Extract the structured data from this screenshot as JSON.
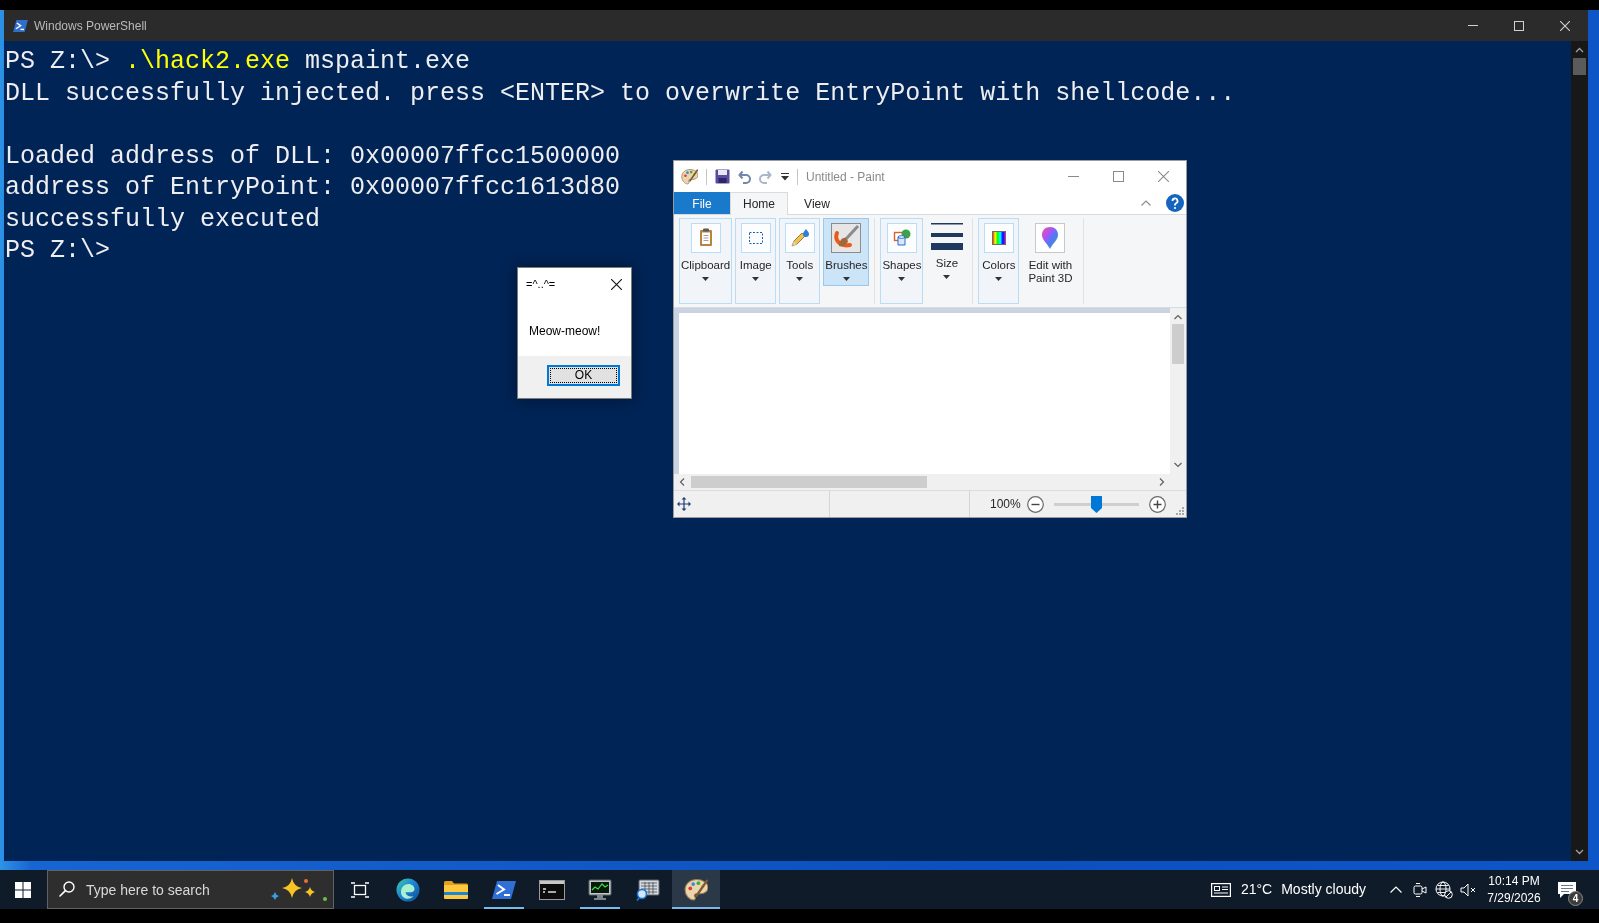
{
  "powershell_window": {
    "title": "Windows PowerShell",
    "lines": [
      {
        "kind": "text",
        "segments": [
          {
            "kind": "prompt",
            "text": "PS Z:\\>"
          },
          {
            "kind": "command",
            "text": ".\\hack2.exe"
          },
          {
            "kind": "argument",
            "text": "mspaint.exe"
          }
        ]
      },
      {
        "kind": "text",
        "segments": [
          {
            "kind": "output",
            "text": "DLL successfully injected. press <ENTER> to overwrite EntryPoint with shellcode..."
          }
        ]
      },
      {
        "kind": "blank"
      },
      {
        "kind": "text",
        "segments": [
          {
            "kind": "output",
            "text": "Loaded address of DLL: 0x00007ffcc1500000"
          }
        ]
      },
      {
        "kind": "text",
        "segments": [
          {
            "kind": "output",
            "text": "address of EntryPoint: 0x00007ffcc1613d80"
          }
        ]
      },
      {
        "kind": "text",
        "segments": [
          {
            "kind": "output",
            "text": "successfully executed"
          }
        ]
      },
      {
        "kind": "text",
        "segments": [
          {
            "kind": "prompt",
            "text": "PS Z:\\>"
          }
        ]
      }
    ]
  },
  "paint_window": {
    "title": "Untitled - Paint",
    "tabs": [
      {
        "label": "File",
        "kind": "menu",
        "selected": false
      },
      {
        "label": "Home",
        "kind": "tab",
        "selected": true
      },
      {
        "label": "View",
        "kind": "tab",
        "selected": false
      }
    ],
    "ribbon_items": [
      {
        "label": "Clipboard",
        "kind": "collapsed",
        "selected": false,
        "dropdown": true
      },
      {
        "label": "Image",
        "kind": "collapsed",
        "selected": false,
        "dropdown": true
      },
      {
        "label": "Tools",
        "kind": "collapsed",
        "selected": false,
        "dropdown": true
      },
      {
        "label": "Brushes",
        "kind": "button",
        "selected": true,
        "dropdown": true
      },
      {
        "kind": "separator"
      },
      {
        "label": "Shapes",
        "kind": "collapsed",
        "selected": false,
        "dropdown": true
      },
      {
        "label": "Size",
        "kind": "button",
        "selected": false,
        "dropdown": true
      },
      {
        "kind": "separator"
      },
      {
        "label": "Colors",
        "kind": "collapsed",
        "selected": false,
        "dropdown": true
      },
      {
        "label": "Edit with Paint 3D",
        "kind": "button",
        "selected": false,
        "dropdown": false
      },
      {
        "kind": "separator"
      }
    ],
    "status_bar": {
      "zoom": "100%",
      "zoom_slider": {
        "level": 0.5
      }
    }
  },
  "message_box": {
    "title": "=^..^=",
    "message": "Meow-meow!",
    "buttons": [
      {
        "label": "OK",
        "focused": true
      }
    ]
  },
  "taskbar": {
    "search": {
      "placeholder": "Type here to search"
    },
    "apps": [
      {
        "running": false,
        "selected": false
      },
      {
        "running": false,
        "selected": false
      },
      {
        "running": true,
        "selected": false
      },
      {
        "running": false,
        "selected": false
      },
      {
        "running": true,
        "selected": false
      },
      {
        "running": false,
        "selected": false
      },
      {
        "running": true,
        "selected": true
      }
    ],
    "weather": {
      "temperature": "21°C",
      "condition": "Mostly cloudy"
    },
    "tray": {
      "network_connected": false,
      "muted": true
    },
    "clock": {
      "time": "10:14 PM",
      "date": "7/29/2026"
    },
    "notifications": {
      "count": "4"
    }
  }
}
